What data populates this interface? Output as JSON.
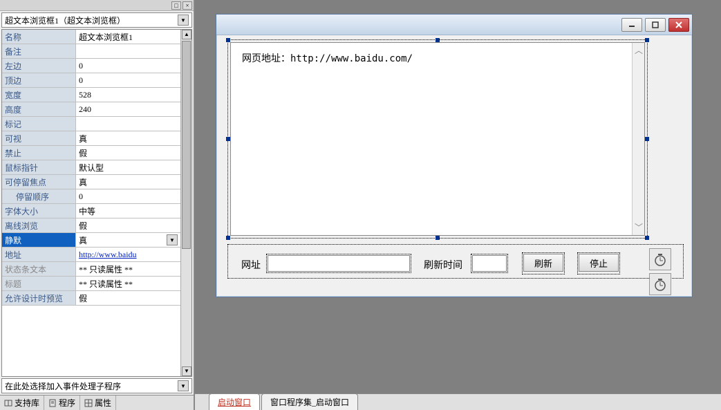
{
  "leftPanel": {
    "topCombo": "超文本浏览框1（超文本浏览框）",
    "props": [
      {
        "label": "名称",
        "value": "超文本浏览框1"
      },
      {
        "label": "备注",
        "value": ""
      },
      {
        "label": "左边",
        "value": "0"
      },
      {
        "label": "顶边",
        "value": "0"
      },
      {
        "label": "宽度",
        "value": "528"
      },
      {
        "label": "高度",
        "value": "240"
      },
      {
        "label": "标记",
        "value": ""
      },
      {
        "label": "可视",
        "value": "真"
      },
      {
        "label": "禁止",
        "value": "假"
      },
      {
        "label": "鼠标指针",
        "value": "默认型"
      },
      {
        "label": "可停留焦点",
        "value": "真"
      },
      {
        "label": "停留顺序",
        "value": "0",
        "indent": true
      },
      {
        "label": "字体大小",
        "value": "中等"
      },
      {
        "label": "离线浏览",
        "value": "假"
      },
      {
        "label": "静默",
        "value": "真",
        "selected": true,
        "dropdown": true
      },
      {
        "label": "地址",
        "value": "http://www.baidu",
        "link": true
      },
      {
        "label": "状态条文本",
        "value": "** 只读属性 **",
        "gray": true
      },
      {
        "label": "标题",
        "value": "** 只读属性 **",
        "gray": true
      },
      {
        "label": "允许设计时预览",
        "value": "假"
      }
    ],
    "bottomCombo": "在此处选择加入事件处理子程序",
    "tabs": {
      "support": "支持库",
      "program": "程序",
      "property": "属性"
    }
  },
  "form": {
    "browserText": "网页地址：http://www.baidu.com/",
    "labels": {
      "url": "网址",
      "refreshTime": "刷新时间"
    },
    "buttons": {
      "refresh": "刷新",
      "stop": "停止"
    }
  },
  "bottomTabs": {
    "active": "启动窗口",
    "second": "窗口程序集_启动窗口"
  }
}
